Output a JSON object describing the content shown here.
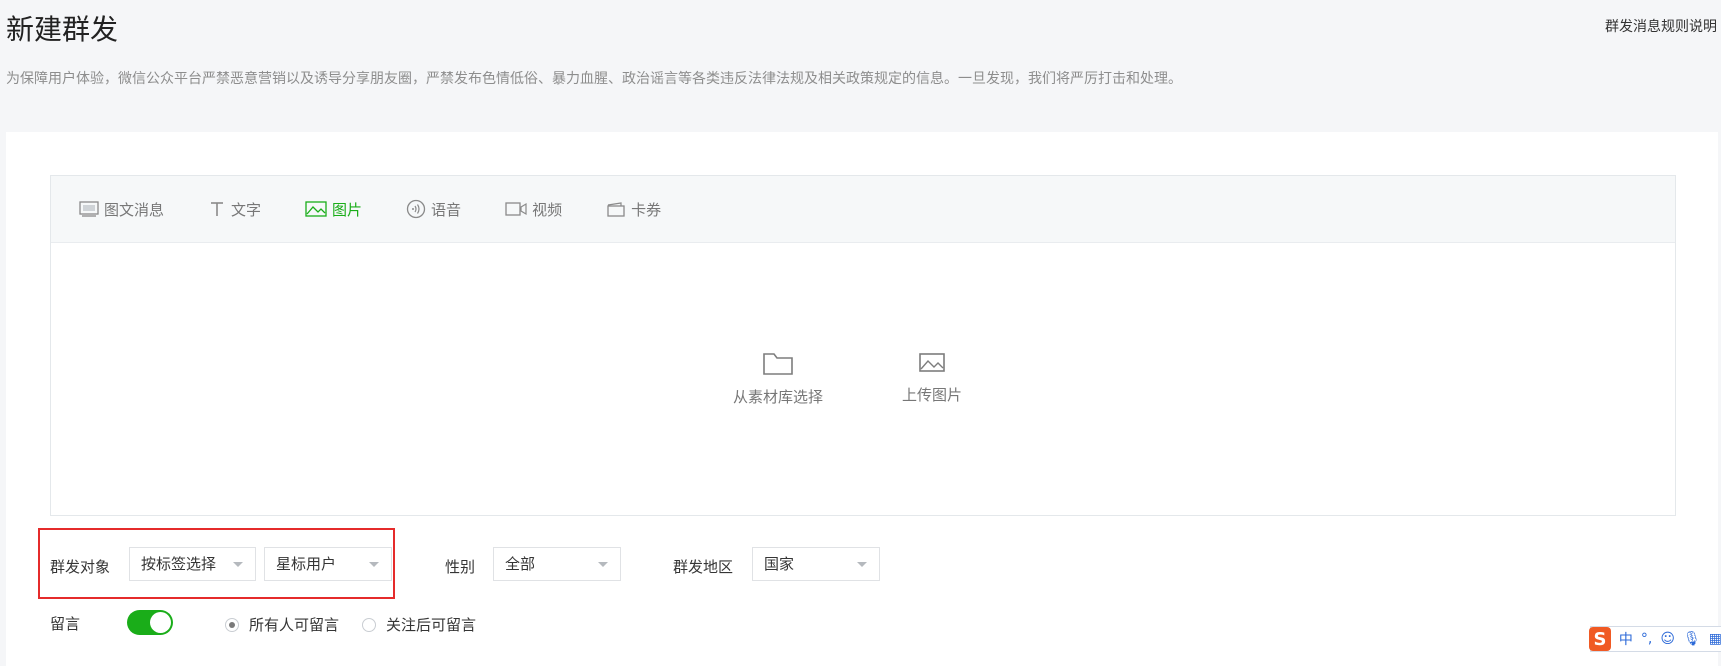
{
  "header": {
    "title": "新建群发",
    "rules_link": "群发消息规则说明",
    "notice": "为保障用户体验，微信公众平台严禁恶意营销以及诱导分享朋友圈，严禁发布色情低俗、暴力血腥、政治谣言等各类违反法律法规及相关政策规定的信息。一旦发现，我们将严厉打击和处理。"
  },
  "editor": {
    "tabs": [
      {
        "label": "图文消息",
        "icon": "news-icon"
      },
      {
        "label": "文字",
        "icon": "text-icon"
      },
      {
        "label": "图片",
        "icon": "image-icon",
        "active": true
      },
      {
        "label": "语音",
        "icon": "voice-icon"
      },
      {
        "label": "视频",
        "icon": "video-icon"
      },
      {
        "label": "卡券",
        "icon": "card-icon"
      }
    ],
    "upload_options": {
      "library": "从素材库选择",
      "upload": "上传图片"
    }
  },
  "form": {
    "target_label": "群发对象",
    "target_select": "按标签选择",
    "tag_select": "星标用户",
    "gender_label": "性别",
    "gender_select": "全部",
    "region_label": "群发地区",
    "region_select": "国家",
    "comment_label": "留言",
    "comment_enabled": true,
    "comment_options": [
      {
        "label": "所有人可留言",
        "checked": true
      },
      {
        "label": "关注后可留言",
        "checked": false
      }
    ]
  },
  "ime": {
    "logo": "S",
    "lang": "中",
    "punct": "°,"
  },
  "colors": {
    "accent": "#1aad19",
    "highlight": "#e52b2b",
    "text": "#353535",
    "muted": "#8d8d8d"
  }
}
